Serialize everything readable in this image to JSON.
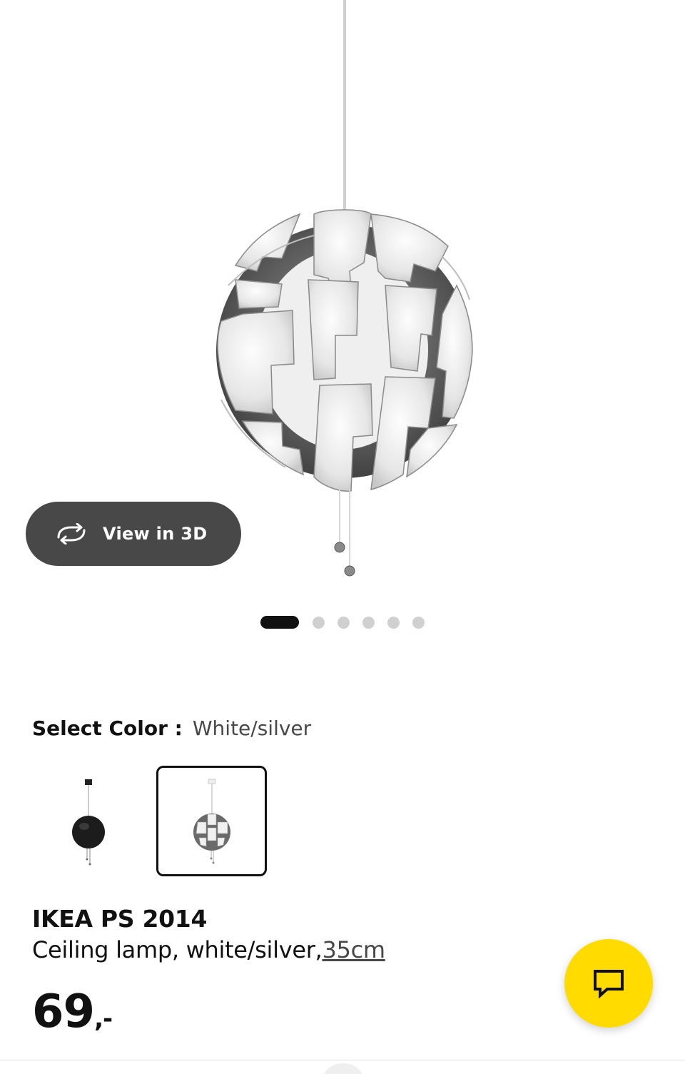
{
  "carousel": {
    "view_3d_label": "View in 3D",
    "view_3d_icon": "rotate-3d-icon",
    "slide_count": 6,
    "active_slide": 1
  },
  "color_selector": {
    "label": "Select Color :",
    "selected_value": "White/silver",
    "options": [
      {
        "name": "Black",
        "icon": "black-lamp-thumbnail"
      },
      {
        "name": "White/silver",
        "icon": "white-silver-lamp-thumbnail",
        "selected": true
      }
    ]
  },
  "product": {
    "name": "IKEA PS 2014",
    "description": "Ceiling lamp, white/silver,",
    "size": "35cm",
    "price": "69",
    "price_suffix": ",-"
  },
  "chat": {
    "icon": "chat-bubble-icon",
    "color": "#FFDB00"
  },
  "colors": {
    "button_dark": "#484848",
    "text_primary": "#111111",
    "text_secondary": "#484848",
    "accent_yellow": "#FFDB00"
  }
}
